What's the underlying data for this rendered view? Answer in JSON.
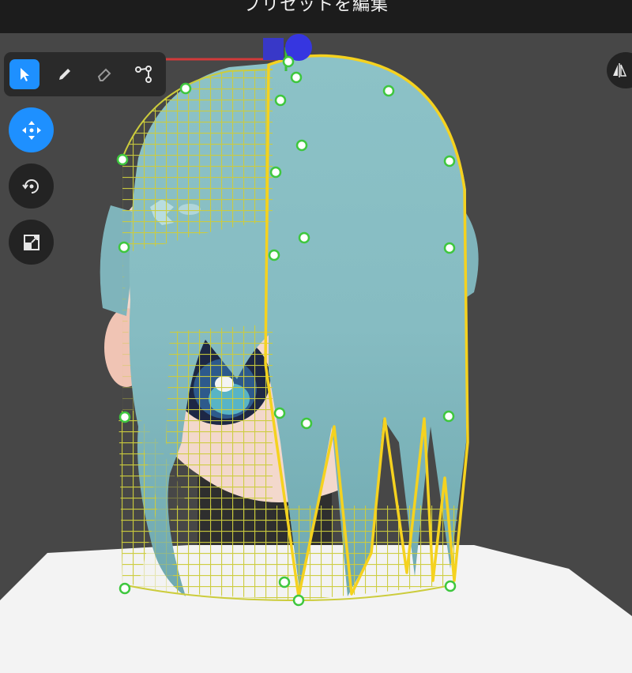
{
  "header": {
    "title": "プリセットを編集"
  },
  "toolbar": {
    "tools": [
      {
        "name": "select",
        "icon": "cursor-arrow-icon",
        "active": true
      },
      {
        "name": "pen",
        "icon": "pencil-icon",
        "active": false
      },
      {
        "name": "eraser",
        "icon": "eraser-icon",
        "active": false
      },
      {
        "name": "path",
        "icon": "node-path-icon",
        "active": false
      }
    ]
  },
  "side_tools": [
    {
      "name": "move",
      "icon": "move-arrows-icon",
      "active": true
    },
    {
      "name": "rotate",
      "icon": "rotate-icon",
      "active": false
    },
    {
      "name": "scale",
      "icon": "scale-icon",
      "active": false
    }
  ],
  "mirror": {
    "icon": "mirror-icon"
  },
  "colors": {
    "accent": "#1e90ff",
    "hair": "#8fc4c9",
    "mesh_outline": "#f5d21f",
    "lattice": "#c8c83a",
    "control_point": "#3ec73e",
    "background": "#474747",
    "titlebar": "#1c1c1c"
  }
}
